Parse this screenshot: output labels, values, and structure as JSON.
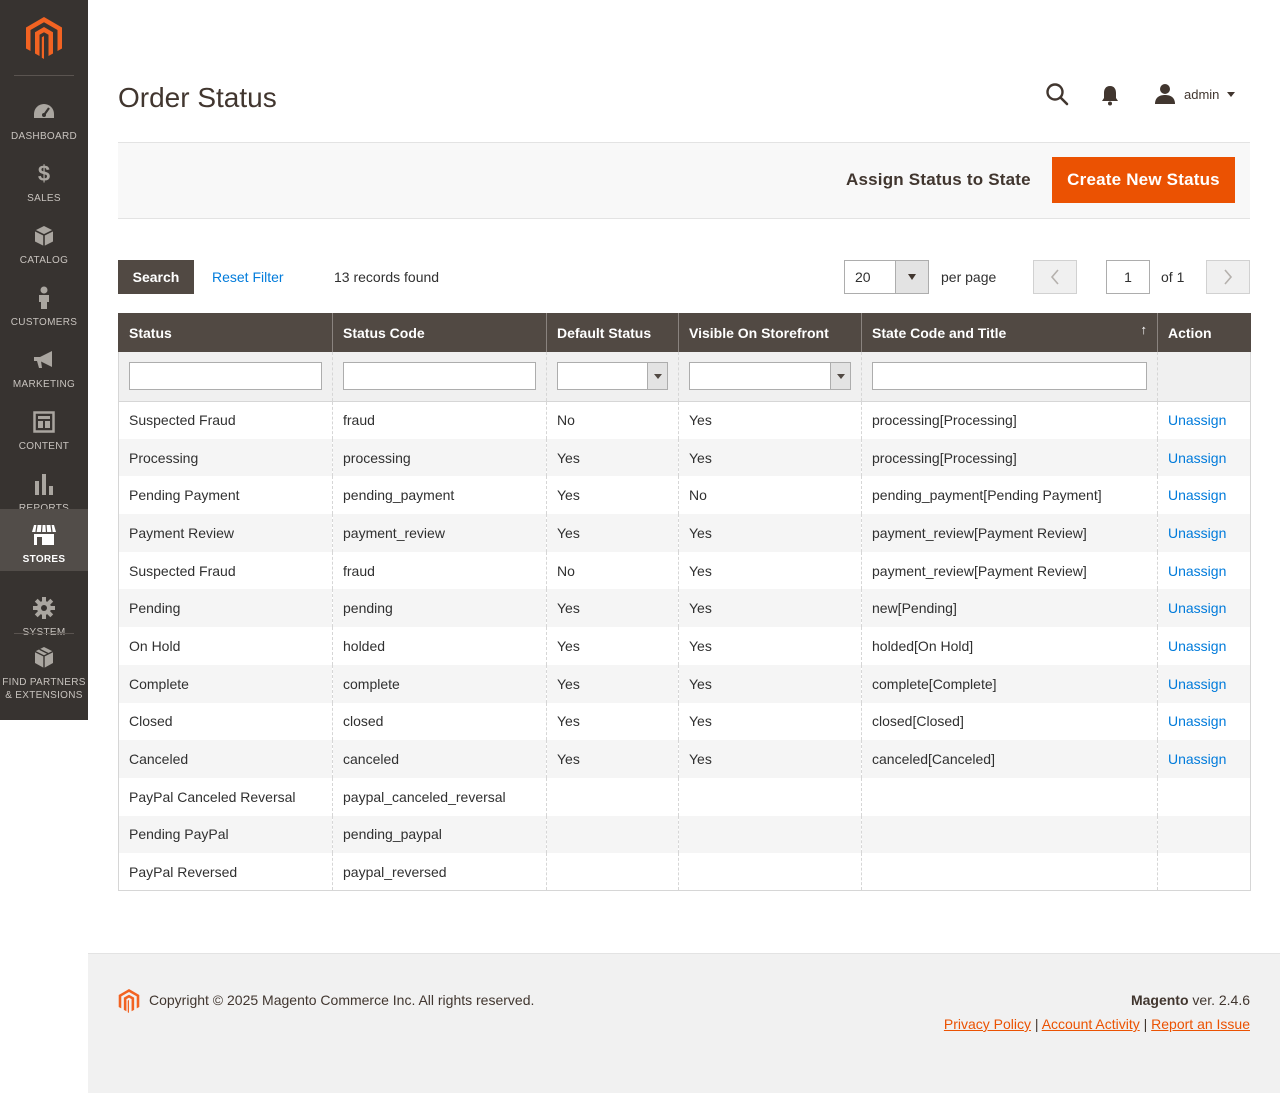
{
  "colors": {
    "accent": "#eb5202",
    "sidebar": "#373330",
    "header_dark": "#514943",
    "link": "#007bdb"
  },
  "sidebar": {
    "items": [
      {
        "label": "DASHBOARD",
        "icon": "dashboard-icon"
      },
      {
        "label": "SALES",
        "icon": "dollar-icon"
      },
      {
        "label": "CATALOG",
        "icon": "box-icon"
      },
      {
        "label": "CUSTOMERS",
        "icon": "person-icon"
      },
      {
        "label": "MARKETING",
        "icon": "megaphone-icon"
      },
      {
        "label": "CONTENT",
        "icon": "layout-icon"
      },
      {
        "label": "REPORTS",
        "icon": "bar-chart-icon"
      },
      {
        "label": "STORES",
        "icon": "store-icon",
        "active": true
      },
      {
        "label": "SYSTEM",
        "icon": "gear-icon"
      },
      {
        "label": "FIND PARTNERS & EXTENSIONS",
        "icon": "cubes-icon"
      }
    ]
  },
  "header": {
    "title": "Order Status",
    "user": "admin"
  },
  "actions": {
    "assign": "Assign Status to State",
    "create": "Create New Status"
  },
  "grid_controls": {
    "search": "Search",
    "reset": "Reset Filter",
    "records": "13 records found",
    "per_page_value": "20",
    "per_page_label": "per page",
    "page": "1",
    "of_pages": "of 1"
  },
  "table": {
    "columns": [
      "Status",
      "Status Code",
      "Default Status",
      "Visible On Storefront",
      "State Code and Title",
      "Action"
    ],
    "sort_indicator": "↑",
    "rows": [
      [
        "Suspected Fraud",
        "fraud",
        "No",
        "Yes",
        "processing[Processing]",
        "Unassign"
      ],
      [
        "Processing",
        "processing",
        "Yes",
        "Yes",
        "processing[Processing]",
        "Unassign"
      ],
      [
        "Pending Payment",
        "pending_payment",
        "Yes",
        "No",
        "pending_payment[Pending Payment]",
        "Unassign"
      ],
      [
        "Payment Review",
        "payment_review",
        "Yes",
        "Yes",
        "payment_review[Payment Review]",
        "Unassign"
      ],
      [
        "Suspected Fraud",
        "fraud",
        "No",
        "Yes",
        "payment_review[Payment Review]",
        "Unassign"
      ],
      [
        "Pending",
        "pending",
        "Yes",
        "Yes",
        "new[Pending]",
        "Unassign"
      ],
      [
        "On Hold",
        "holded",
        "Yes",
        "Yes",
        "holded[On Hold]",
        "Unassign"
      ],
      [
        "Complete",
        "complete",
        "Yes",
        "Yes",
        "complete[Complete]",
        "Unassign"
      ],
      [
        "Closed",
        "closed",
        "Yes",
        "Yes",
        "closed[Closed]",
        "Unassign"
      ],
      [
        "Canceled",
        "canceled",
        "Yes",
        "Yes",
        "canceled[Canceled]",
        "Unassign"
      ],
      [
        "PayPal Canceled Reversal",
        "paypal_canceled_reversal",
        "",
        "",
        "",
        ""
      ],
      [
        "Pending PayPal",
        "pending_paypal",
        "",
        "",
        "",
        ""
      ],
      [
        "PayPal Reversed",
        "paypal_reversed",
        "",
        "",
        "",
        ""
      ]
    ]
  },
  "footer": {
    "copyright": "Copyright © 2025 Magento Commerce Inc. All rights reserved.",
    "brand": "Magento",
    "version": " ver. 2.4.6",
    "links": [
      "Privacy Policy",
      " Account Activity",
      "Report an Issue"
    ],
    "separator": "|"
  }
}
